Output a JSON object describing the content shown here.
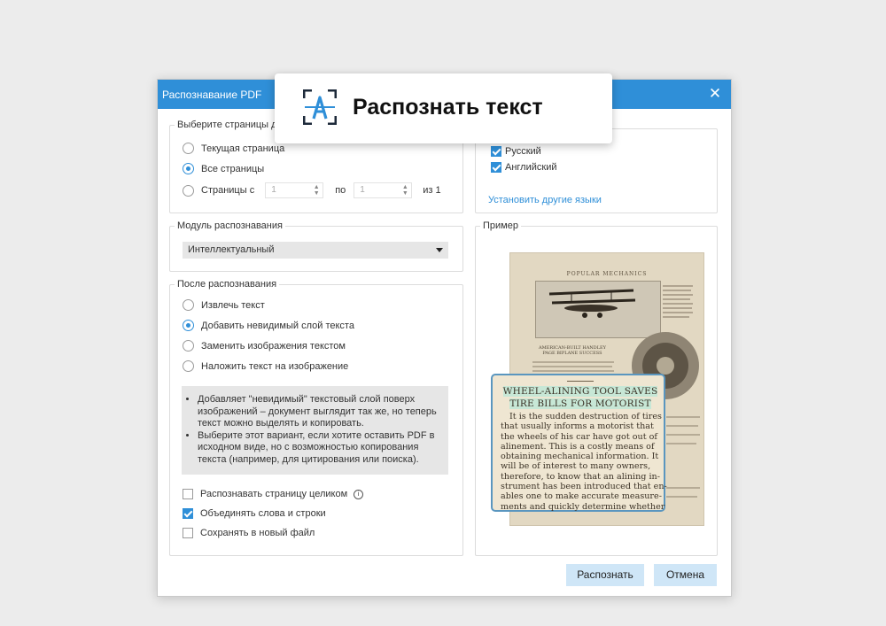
{
  "dialog": {
    "title": "Распознавание PDF",
    "close_icon": "close-icon"
  },
  "callout": {
    "icon": "text-recognition-icon",
    "label": "Распознать текст"
  },
  "pages": {
    "legend": "Выберите страницы дл",
    "option_current": "Текущая страница",
    "option_all": "Все страницы",
    "option_range": "Страницы с",
    "range_from": "1",
    "range_to_label": "по",
    "range_to": "1",
    "range_of": "из 1",
    "selected": "all"
  },
  "languages": {
    "items": [
      {
        "label": "Русский",
        "checked": true
      },
      {
        "label": "Английский",
        "checked": true
      }
    ],
    "install_link": "Установить другие языки"
  },
  "engine": {
    "legend": "Модуль распознавания",
    "value": "Интеллектуальный"
  },
  "after": {
    "legend": "После распознавания",
    "options": [
      {
        "label": "Извлечь текст",
        "selected": false
      },
      {
        "label": "Добавить невидимый слой текста",
        "selected": true
      },
      {
        "label": "Заменить изображения текстом",
        "selected": false
      },
      {
        "label": "Наложить текст на изображение",
        "selected": false
      }
    ],
    "description": [
      "Добавляет \"невидимый\" текстовый слой поверх изображений – документ выглядит так же, но теперь текст можно выделять и копировать.",
      "Выберите этот вариант, если хотите оставить PDF в исходном виде, но с возможностью копирования текста (например, для цитирования или поиска)."
    ]
  },
  "checkboxes": [
    {
      "label": "Распознавать страницу целиком",
      "checked": false,
      "info_icon": "info-icon"
    },
    {
      "label": "Объединять слова и строки",
      "checked": true
    },
    {
      "label": "Сохранять в новый файл",
      "checked": false
    }
  ],
  "preview": {
    "legend": "Пример",
    "header": "POPULAR MECHANICS",
    "caption": "AMERICAN-BUILT HANDLEY PAGE BIPLANE SUCCESS",
    "snippet_title_1": "WHEEL-ALINING TOOL SAVES",
    "snippet_title_2": "TIRE BILLS FOR MOTORIST",
    "snippet_lines": [
      "It is the sudden destruction of tires",
      "that usually informs a motorist that",
      "the wheels of his car have got out of",
      "alinement.  This is a costly means of",
      "obtaining mechanical information.  It",
      "will be of interest to many owners,",
      "therefore, to know that an alining in-",
      "strument has been introduced that en-",
      "ables one to make accurate measure-",
      "ments and quickly determine whether"
    ]
  },
  "buttons": {
    "recognize": "Распознать",
    "cancel": "Отмена"
  }
}
